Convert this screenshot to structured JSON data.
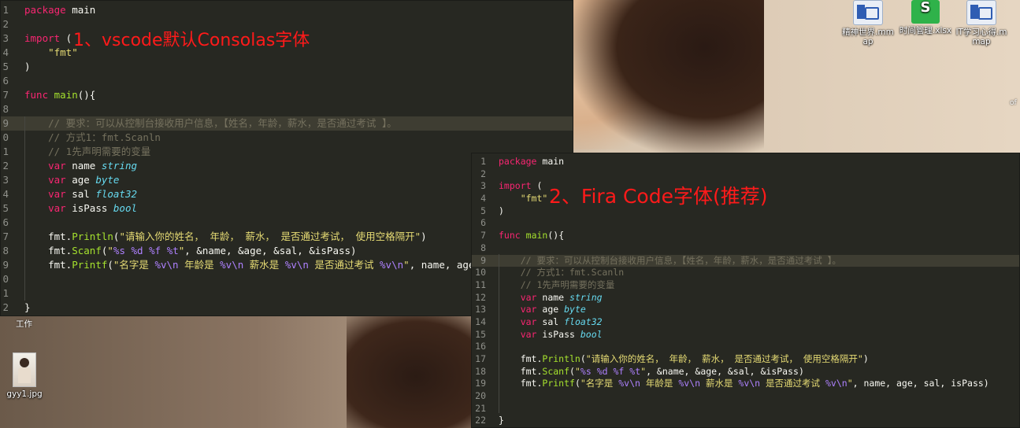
{
  "annotations": {
    "first": "1、vscode默认Consolas字体",
    "second": "2、Fira Code字体(推荐)"
  },
  "desktop": {
    "icons": [
      {
        "label": "精神世界.mmap",
        "type": "mmap"
      },
      {
        "label": "时间管理.xlsx",
        "type": "xls",
        "glyph": "S"
      },
      {
        "label": "IT学习心得.mmap",
        "type": "mmap"
      },
      {
        "label": "gyy1.jpg",
        "type": "jpg"
      }
    ],
    "fragments": {
      "work": "工作",
      "right_edge": "of"
    }
  },
  "code": {
    "lines": [
      {
        "n": "1",
        "t": "package main"
      },
      {
        "n": "2",
        "t": ""
      },
      {
        "n": "3",
        "t": "import ("
      },
      {
        "n": "4",
        "t": "    \"fmt\""
      },
      {
        "n": "5",
        "t": ")"
      },
      {
        "n": "6",
        "t": ""
      },
      {
        "n": "7",
        "t": "func main(){"
      },
      {
        "n": "8",
        "t": ""
      },
      {
        "n": "9",
        "t": "    // 要求：可以从控制台接收用户信息，【姓名，年龄，薪水，是否通过考试 】。"
      },
      {
        "n": "10",
        "t": "    // 方式1：fmt.Scanln"
      },
      {
        "n": "11",
        "t": "    // 1先声明需要的变量"
      },
      {
        "n": "12",
        "t": "    var name string"
      },
      {
        "n": "13",
        "t": "    var age byte"
      },
      {
        "n": "14",
        "t": "    var sal float32"
      },
      {
        "n": "15",
        "t": "    var isPass bool"
      },
      {
        "n": "16",
        "t": ""
      },
      {
        "n": "17",
        "t": "    fmt.Println(\"请输入你的姓名， 年龄， 薪水， 是否通过考试， 使用空格隔开\")"
      },
      {
        "n": "18",
        "t": "    fmt.Scanf(\"%s %d %f %t\", &name, &age, &sal, &isPass)"
      },
      {
        "n": "19",
        "t": "    fmt.Printf(\"名字是 %v\\n 年龄是 %v\\n 薪水是 %v\\n 是否通过考试 %v\\n\", name, age, sal, isPass)"
      },
      {
        "n": "20",
        "t": ""
      },
      {
        "n": "21",
        "t": ""
      },
      {
        "n": "22",
        "t": "}"
      }
    ]
  },
  "editor1": {
    "visible_line_numbers": [
      "1",
      "2",
      "3",
      "4",
      "5",
      "6",
      "7",
      "8",
      "9",
      "0",
      "1",
      "2",
      "3",
      "4",
      "5",
      "6",
      "7",
      "8",
      "9",
      "0",
      "1",
      "2"
    ]
  },
  "theme": {
    "background": "#272822",
    "keyword": "#f92672",
    "function": "#a6e22e",
    "string": "#e6db74",
    "type": "#66d9ef",
    "comment": "#75715e",
    "annotation": "#ff1a1a"
  }
}
